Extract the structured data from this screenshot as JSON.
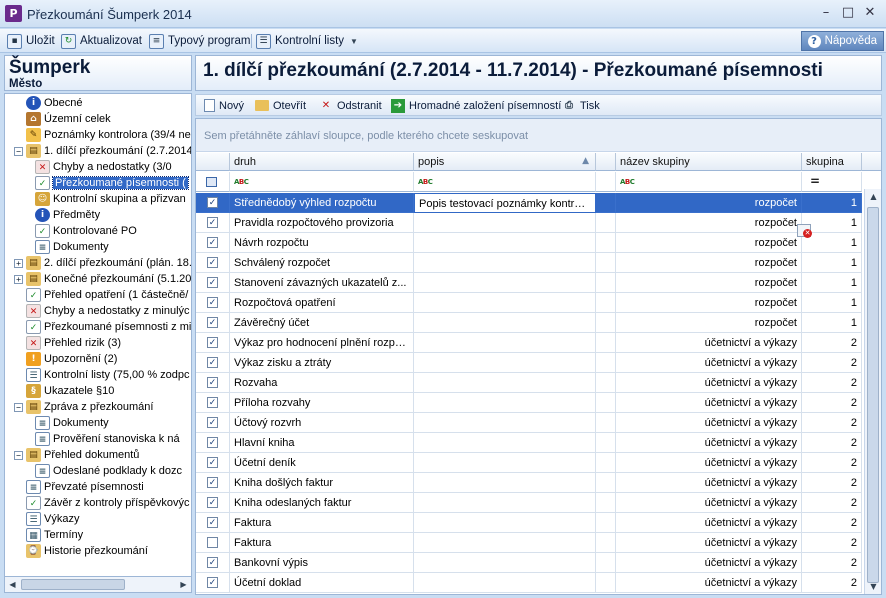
{
  "window": {
    "title": "Přezkoumání Šumperk 2014",
    "app_icon": "P"
  },
  "toolbar": {
    "save": "Uložit",
    "refresh": "Aktualizovat",
    "typical_program": "Typový program",
    "checklists": "Kontrolní listy",
    "help": "Nápověda"
  },
  "left": {
    "title": "Šumperk",
    "subtitle": "Město",
    "tree": [
      {
        "label": "Obecné",
        "icon": "info-icon"
      },
      {
        "label": "Územní celek",
        "icon": "house-icon"
      },
      {
        "label": "Poznámky kontrolora (39/4 ne",
        "icon": "notes-icon"
      },
      {
        "label": "1. dílčí přezkoumání (2.7.2014",
        "icon": "folder-icon"
      },
      {
        "label": "Chyby a nedostatky (3/0",
        "icon": "error-doc-icon"
      },
      {
        "label": "Přezkoumané písemnosti (",
        "icon": "checked-doc-icon"
      },
      {
        "label": "Kontrolní skupina a přizvan",
        "icon": "group-icon"
      },
      {
        "label": "Předměty",
        "icon": "info-icon"
      },
      {
        "label": "Kontrolované PO",
        "icon": "checked-doc-icon"
      },
      {
        "label": "Dokumenty",
        "icon": "doc-icon"
      },
      {
        "label": "2. dílčí přezkoumání (plán. 18.",
        "icon": "folder-icon"
      },
      {
        "label": "Konečné přezkoumání (5.1.20",
        "icon": "folder-icon"
      },
      {
        "label": "Přehled opatření (1 částečně/",
        "icon": "checked-doc-icon"
      },
      {
        "label": "Chyby a nedostatky z minulýc",
        "icon": "error-doc-icon"
      },
      {
        "label": "Přezkoumané písemnosti z mir",
        "icon": "checked-doc-icon"
      },
      {
        "label": "Přehled rizik (3)",
        "icon": "error-doc-icon"
      },
      {
        "label": "Upozornění (2)",
        "icon": "warning-icon"
      },
      {
        "label": "Kontrolní listy (75,00 % zodpc",
        "icon": "list-icon"
      },
      {
        "label": "Ukazatele §10",
        "icon": "indicator-icon"
      },
      {
        "label": "Zpráva z přezkoumání",
        "icon": "folder-icon"
      },
      {
        "label": "Dokumenty",
        "icon": "doc-icon"
      },
      {
        "label": "Prověření stanoviska k ná",
        "icon": "doc-icon"
      },
      {
        "label": "Přehled dokumentů",
        "icon": "folder-icon"
      },
      {
        "label": "Odeslané podklady k dozc",
        "icon": "doc-icon"
      },
      {
        "label": "Převzaté písemnosti",
        "icon": "doc-icon"
      },
      {
        "label": "Závěr z kontroly příspěvkovýc",
        "icon": "checked-doc-icon"
      },
      {
        "label": "Výkazy",
        "icon": "list-icon"
      },
      {
        "label": "Termíny",
        "icon": "calendar-icon"
      },
      {
        "label": "Historie přezkoumání",
        "icon": "history-icon"
      }
    ]
  },
  "main": {
    "title": "1. dílčí přezkoumání (2.7.2014 - 11.7.2014) - Přezkoumané písemnosti",
    "actions": {
      "new": "Nový",
      "open": "Otevřít",
      "remove": "Odstranit",
      "bulk_create": "Hromadné založení písemností",
      "print": "Tisk"
    },
    "group_hint": "Sem přetáhněte záhlaví sloupce, podle kterého chcete seskupovat",
    "columns": {
      "druh": "druh",
      "popis": "popis",
      "group_name": "název skupiny",
      "group": "skupina"
    },
    "rows": [
      {
        "checked": true,
        "druh": "Střednědobý výhled rozpočtu",
        "popis": "Popis testovací poznámky kontrol...",
        "group_name": "rozpočet",
        "group": "1"
      },
      {
        "checked": true,
        "druh": "Pravidla rozpočtového provizoria",
        "popis": "",
        "group_name": "rozpočet",
        "group": "1"
      },
      {
        "checked": true,
        "druh": "Návrh rozpočtu",
        "popis": "",
        "group_name": "rozpočet",
        "group": "1"
      },
      {
        "checked": true,
        "druh": "Schválený rozpočet",
        "popis": "",
        "group_name": "rozpočet",
        "group": "1"
      },
      {
        "checked": true,
        "druh": "Stanovení závazných ukazatelů z...",
        "popis": "",
        "group_name": "rozpočet",
        "group": "1"
      },
      {
        "checked": true,
        "druh": "Rozpočtová opatření",
        "popis": "",
        "group_name": "rozpočet",
        "group": "1"
      },
      {
        "checked": true,
        "druh": "Závěrečný účet",
        "popis": "",
        "group_name": "rozpočet",
        "group": "1"
      },
      {
        "checked": true,
        "druh": "Výkaz pro hodnocení plnění rozpo...",
        "popis": "",
        "group_name": "účetnictví a výkazy",
        "group": "2"
      },
      {
        "checked": true,
        "druh": "Výkaz zisku a ztráty",
        "popis": "",
        "group_name": "účetnictví a výkazy",
        "group": "2"
      },
      {
        "checked": true,
        "druh": "Rozvaha",
        "popis": "",
        "group_name": "účetnictví a výkazy",
        "group": "2"
      },
      {
        "checked": true,
        "druh": "Příloha rozvahy",
        "popis": "",
        "group_name": "účetnictví a výkazy",
        "group": "2"
      },
      {
        "checked": true,
        "druh": "Účtový rozvrh",
        "popis": "",
        "group_name": "účetnictví a výkazy",
        "group": "2"
      },
      {
        "checked": true,
        "druh": "Hlavní kniha",
        "popis": "",
        "group_name": "účetnictví a výkazy",
        "group": "2"
      },
      {
        "checked": true,
        "druh": "Účetní deník",
        "popis": "",
        "group_name": "účetnictví a výkazy",
        "group": "2"
      },
      {
        "checked": true,
        "druh": "Kniha došlých faktur",
        "popis": "",
        "group_name": "účetnictví a výkazy",
        "group": "2"
      },
      {
        "checked": true,
        "druh": "Kniha odeslaných faktur",
        "popis": "",
        "group_name": "účetnictví a výkazy",
        "group": "2"
      },
      {
        "checked": true,
        "druh": "Faktura",
        "popis": "",
        "group_name": "účetnictví a výkazy",
        "group": "2"
      },
      {
        "checked": false,
        "druh": "Faktura",
        "popis": "",
        "group_name": "účetnictví a výkazy",
        "group": "2"
      },
      {
        "checked": true,
        "druh": "Bankovní výpis",
        "popis": "",
        "group_name": "účetnictví a výkazy",
        "group": "2"
      },
      {
        "checked": true,
        "druh": "Účetní doklad",
        "popis": "",
        "group_name": "účetnictví a výkazy",
        "group": "2"
      }
    ]
  }
}
